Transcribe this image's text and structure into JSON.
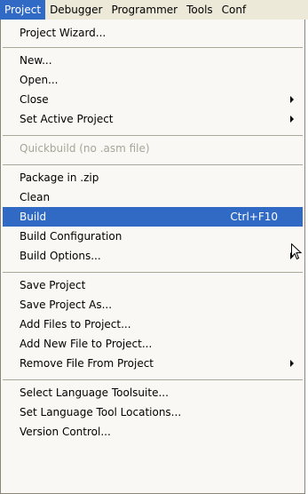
{
  "menubar": {
    "items": [
      {
        "label": "Project"
      },
      {
        "label": "Debugger"
      },
      {
        "label": "Programmer"
      },
      {
        "label": "Tools"
      },
      {
        "label": "Conf"
      }
    ]
  },
  "menu": {
    "items": [
      {
        "label": "Project Wizard..."
      },
      {
        "label": "New..."
      },
      {
        "label": "Open..."
      },
      {
        "label": "Close"
      },
      {
        "label": "Set Active Project"
      },
      {
        "label": "Quickbuild (no .asm file)"
      },
      {
        "label": "Package in .zip"
      },
      {
        "label": "Clean"
      },
      {
        "label": "Build",
        "shortcut": "Ctrl+F10"
      },
      {
        "label": "Build Configuration"
      },
      {
        "label": "Build Options..."
      },
      {
        "label": "Save Project"
      },
      {
        "label": "Save Project As..."
      },
      {
        "label": "Add Files to Project..."
      },
      {
        "label": "Add New File to Project..."
      },
      {
        "label": "Remove File From Project"
      },
      {
        "label": "Select Language Toolsuite..."
      },
      {
        "label": "Set Language Tool Locations..."
      },
      {
        "label": "Version Control..."
      }
    ]
  },
  "colors": {
    "selection": "#316ac5",
    "menu_background": "#f9f8f4",
    "menubar_background": "#ece9d8",
    "disabled_text": "#a8a597"
  }
}
